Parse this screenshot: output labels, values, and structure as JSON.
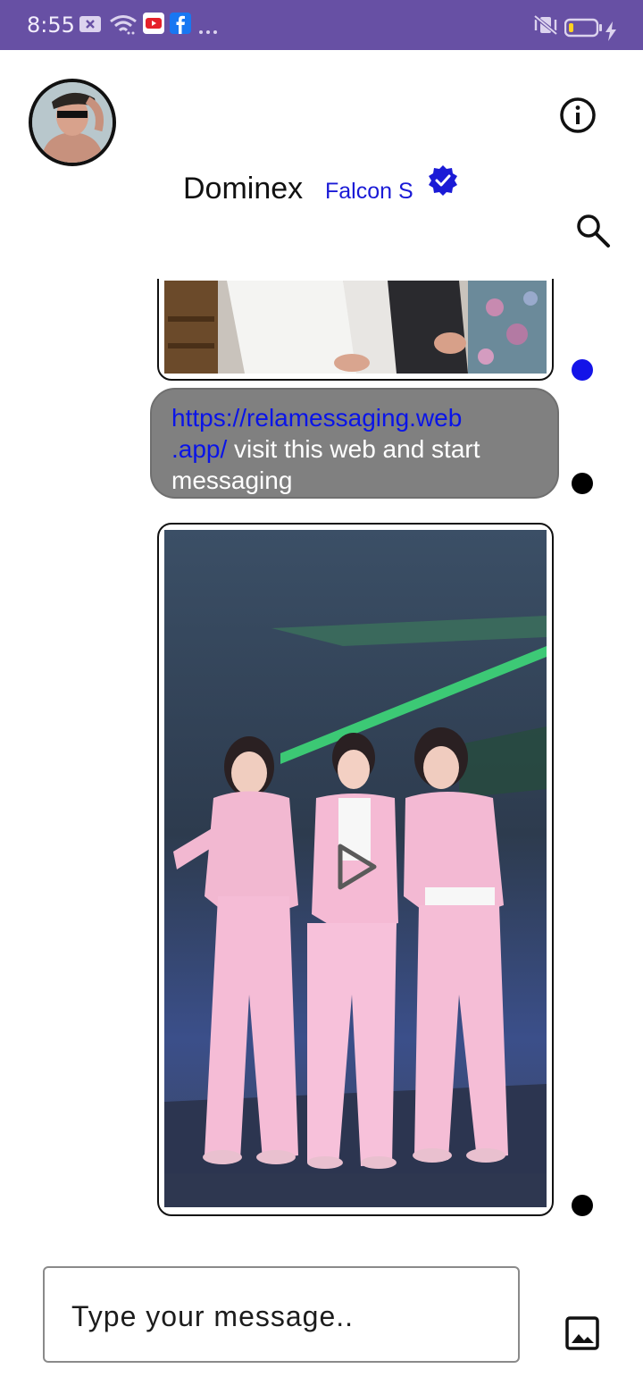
{
  "status_bar": {
    "time": "8:55",
    "background": "#6750a4",
    "icons": [
      "close-box-icon",
      "wifi-icon",
      "youtube-icon",
      "facebook-icon",
      "more-dots-icon",
      "vibrate-silent-icon",
      "battery-low-icon",
      "charging-bolt-icon"
    ]
  },
  "header": {
    "name": "Dominex",
    "subtitle": "Falcon S",
    "verified_icon": "verified-badge-icon",
    "accent": "#1a1ad6"
  },
  "messages": [
    {
      "type": "image",
      "partial": true,
      "status": "blue-dot"
    },
    {
      "type": "text",
      "link_line1": "https://relamessaging.web",
      "link_line2": ".app/",
      "rest_line2": " visit this web and start",
      "line3": "messaging",
      "status": "black-dot"
    },
    {
      "type": "video",
      "status": "black-dot",
      "icon": "play-icon"
    }
  ],
  "composer": {
    "placeholder": "Type your message..",
    "attach_icon": "image-gallery-icon"
  }
}
